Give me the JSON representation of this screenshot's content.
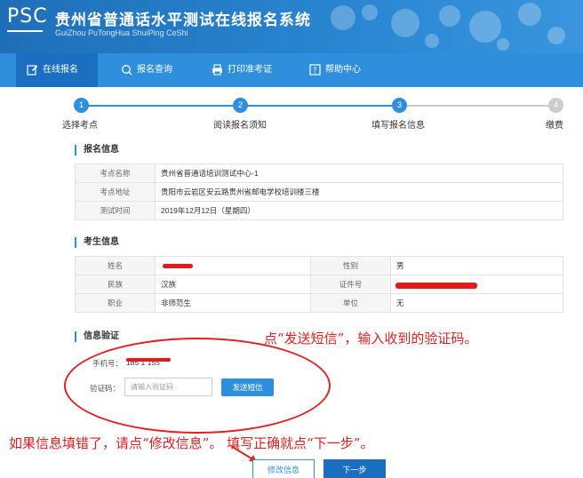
{
  "header": {
    "logo": "PSC",
    "title": "贵州省普通话水平测试在线报名系统",
    "subtitle": "GuiZhou PuTongHua ShuiPing CeShi"
  },
  "nav": [
    {
      "label": "在线报名",
      "icon": "edit-icon"
    },
    {
      "label": "报名查询",
      "icon": "search-icon"
    },
    {
      "label": "打印准考证",
      "icon": "printer-icon"
    },
    {
      "label": "帮助中心",
      "icon": "help-icon"
    }
  ],
  "steps": [
    {
      "num": "1",
      "label": "选择考点"
    },
    {
      "num": "2",
      "label": "阅读报名须知"
    },
    {
      "num": "3",
      "label": "填写报名信息"
    },
    {
      "num": "4",
      "label": "缴费"
    }
  ],
  "sections": {
    "registration": "报名信息",
    "candidate": "考生信息",
    "verify": "信息验证"
  },
  "registration": [
    {
      "k": "考点名称",
      "v": "贵州省普通话培训测试中心-1"
    },
    {
      "k": "考点地址",
      "v": "贵阳市云岩区安云路贵州省邮电学校培训楼三楼"
    },
    {
      "k": "测试时间",
      "v": "2019年12月12日（星期四）"
    }
  ],
  "candidate": {
    "name_label": "姓名",
    "name_value": "",
    "gender_label": "性别",
    "gender_value": "男",
    "ethnicity_label": "民族",
    "ethnicity_value": "汉族",
    "id_label": "证件号",
    "id_value": "",
    "job_label": "职业",
    "job_value": "非师范生",
    "unit_label": "单位",
    "unit_value": "无"
  },
  "verify": {
    "phone_label": "手机号：",
    "phone_value": "185 1 155",
    "code_label": "验证码：",
    "code_placeholder": "请输入验证码",
    "send_button": "发送短信"
  },
  "annotations": {
    "send_hint": "点“发送短信”，输入收到的验证码。",
    "bottom_hint": "如果信息填错了，请点“修改信息”。 填写正确就点“下一步”。"
  },
  "buttons": {
    "edit": "修改信息",
    "next": "下一步"
  },
  "colors": {
    "primary": "#2f8fdc",
    "nav_active": "#1a6fc0",
    "annotation": "#e32020"
  }
}
